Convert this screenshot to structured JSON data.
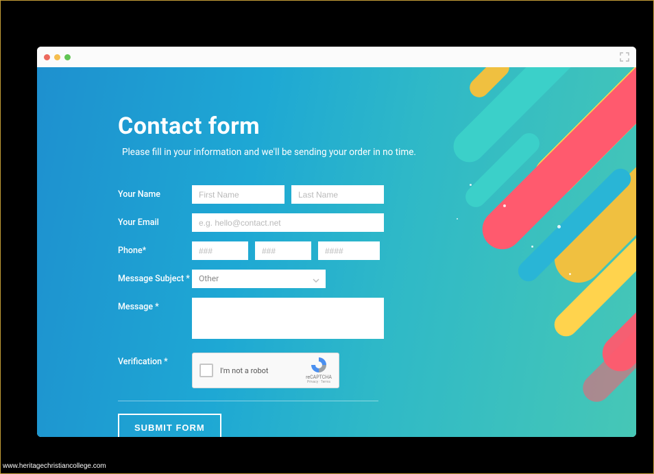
{
  "page": {
    "title": "Contact form",
    "subtitle": "Please fill in your information and we'll be sending your order in no time."
  },
  "labels": {
    "name": "Your Name",
    "email": "Your Email",
    "phone": "Phone*",
    "subject": "Message Subject *",
    "message": "Message *",
    "verification": "Verification *"
  },
  "placeholders": {
    "first_name": "First Name",
    "last_name": "Last Name",
    "email": "e.g. hello@contact.net",
    "phone1": "###",
    "phone2": "###",
    "phone3": "####"
  },
  "select": {
    "subject_value": "Other"
  },
  "captcha": {
    "text": "I'm not a robot",
    "brand": "reCAPTCHA",
    "small": "Privacy · Terms"
  },
  "submit": {
    "label": "SUBMIT FORM"
  },
  "watermark": "www.heritagechristiancollege.com"
}
